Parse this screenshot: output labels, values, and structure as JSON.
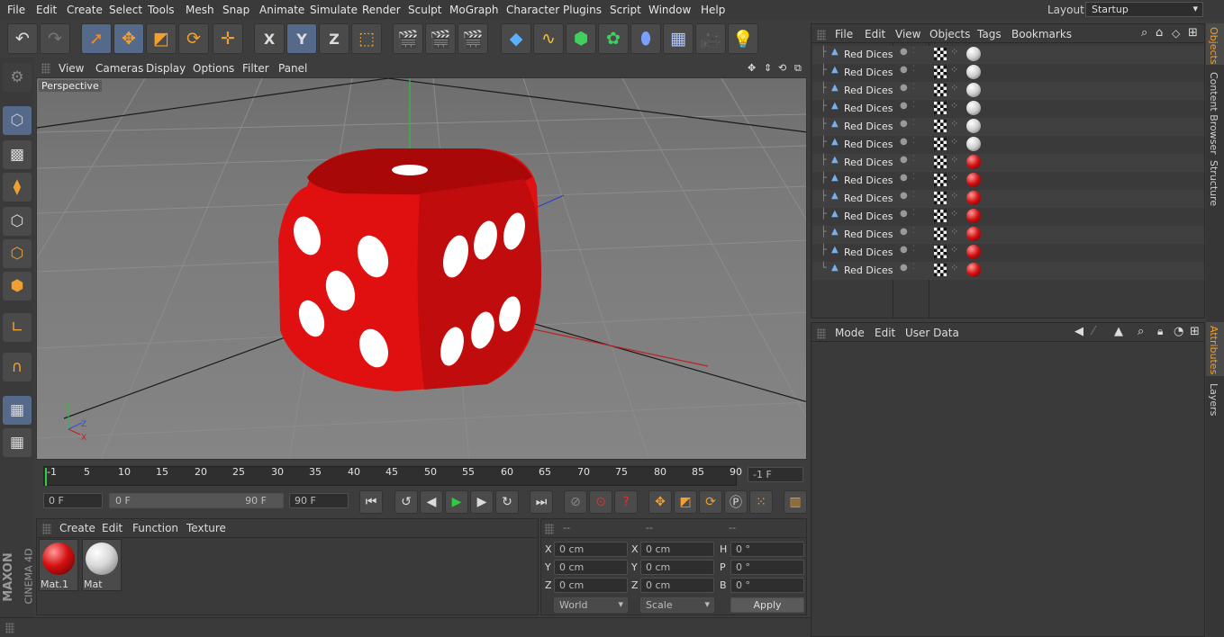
{
  "menu": [
    "File",
    "Edit",
    "Create",
    "Select",
    "Tools",
    "Mesh",
    "Snap",
    "Animate",
    "Simulate",
    "Render",
    "Sculpt",
    "MoGraph",
    "Character",
    "Plugins",
    "Script",
    "Window",
    "Help"
  ],
  "layout": {
    "label": "Layout:",
    "value": "Startup"
  },
  "axis": {
    "x": "X",
    "y": "Y",
    "z": "Z"
  },
  "viewport": {
    "menu": [
      "View",
      "Cameras",
      "Display",
      "Options",
      "Filter",
      "Panel"
    ],
    "label": "Perspective"
  },
  "timeline": {
    "ticks": [
      "-1",
      "5",
      "10",
      "15",
      "20",
      "25",
      "30",
      "35",
      "40",
      "45",
      "50",
      "55",
      "60",
      "65",
      "70",
      "75",
      "80",
      "85",
      "90"
    ],
    "end_frame": "-1 F"
  },
  "transport": {
    "current": "0 F",
    "range_start": "0 F",
    "range_end": "90 F",
    "max": "90 F"
  },
  "materials": {
    "menu": [
      "Create",
      "Edit",
      "Function",
      "Texture"
    ],
    "items": [
      {
        "name": "Mat.1",
        "color": "#d41010"
      },
      {
        "name": "Mat",
        "color": "#e0e0e0"
      }
    ]
  },
  "coords": {
    "headers": [
      "--",
      "--",
      "--"
    ],
    "rows": [
      {
        "l1": "X",
        "v1": "0 cm",
        "l2": "X",
        "v2": "0 cm",
        "l3": "H",
        "v3": "0 °"
      },
      {
        "l1": "Y",
        "v1": "0 cm",
        "l2": "Y",
        "v2": "0 cm",
        "l3": "P",
        "v3": "0 °"
      },
      {
        "l1": "Z",
        "v1": "0 cm",
        "l2": "Z",
        "v2": "0 cm",
        "l3": "B",
        "v3": "0 °"
      }
    ],
    "mode": "World",
    "type": "Scale",
    "apply": "Apply"
  },
  "objects": {
    "menu": [
      "File",
      "Edit",
      "View",
      "Objects",
      "Tags",
      "Bookmarks"
    ],
    "rows": [
      {
        "name": "Red Dices",
        "mat": "white"
      },
      {
        "name": "Red Dices",
        "mat": "white"
      },
      {
        "name": "Red Dices",
        "mat": "white"
      },
      {
        "name": "Red Dices",
        "mat": "white"
      },
      {
        "name": "Red Dices",
        "mat": "white"
      },
      {
        "name": "Red Dices",
        "mat": "white"
      },
      {
        "name": "Red Dices",
        "mat": "red"
      },
      {
        "name": "Red Dices",
        "mat": "red"
      },
      {
        "name": "Red Dices",
        "mat": "red"
      },
      {
        "name": "Red Dices",
        "mat": "red"
      },
      {
        "name": "Red Dices",
        "mat": "red"
      },
      {
        "name": "Red Dices",
        "mat": "red"
      },
      {
        "name": "Red Dices",
        "mat": "red"
      }
    ]
  },
  "attributes": {
    "menu": [
      "Mode",
      "Edit",
      "User Data"
    ]
  },
  "side_tabs": [
    "Objects",
    "Content Browser",
    "Structure",
    "Attributes",
    "Layers"
  ],
  "brand": {
    "line1": "MAXON",
    "line2": "CINEMA 4D"
  },
  "colors": {
    "accent": "#55698a",
    "dice": "#e01010",
    "playgreen": "#2ecc40"
  }
}
